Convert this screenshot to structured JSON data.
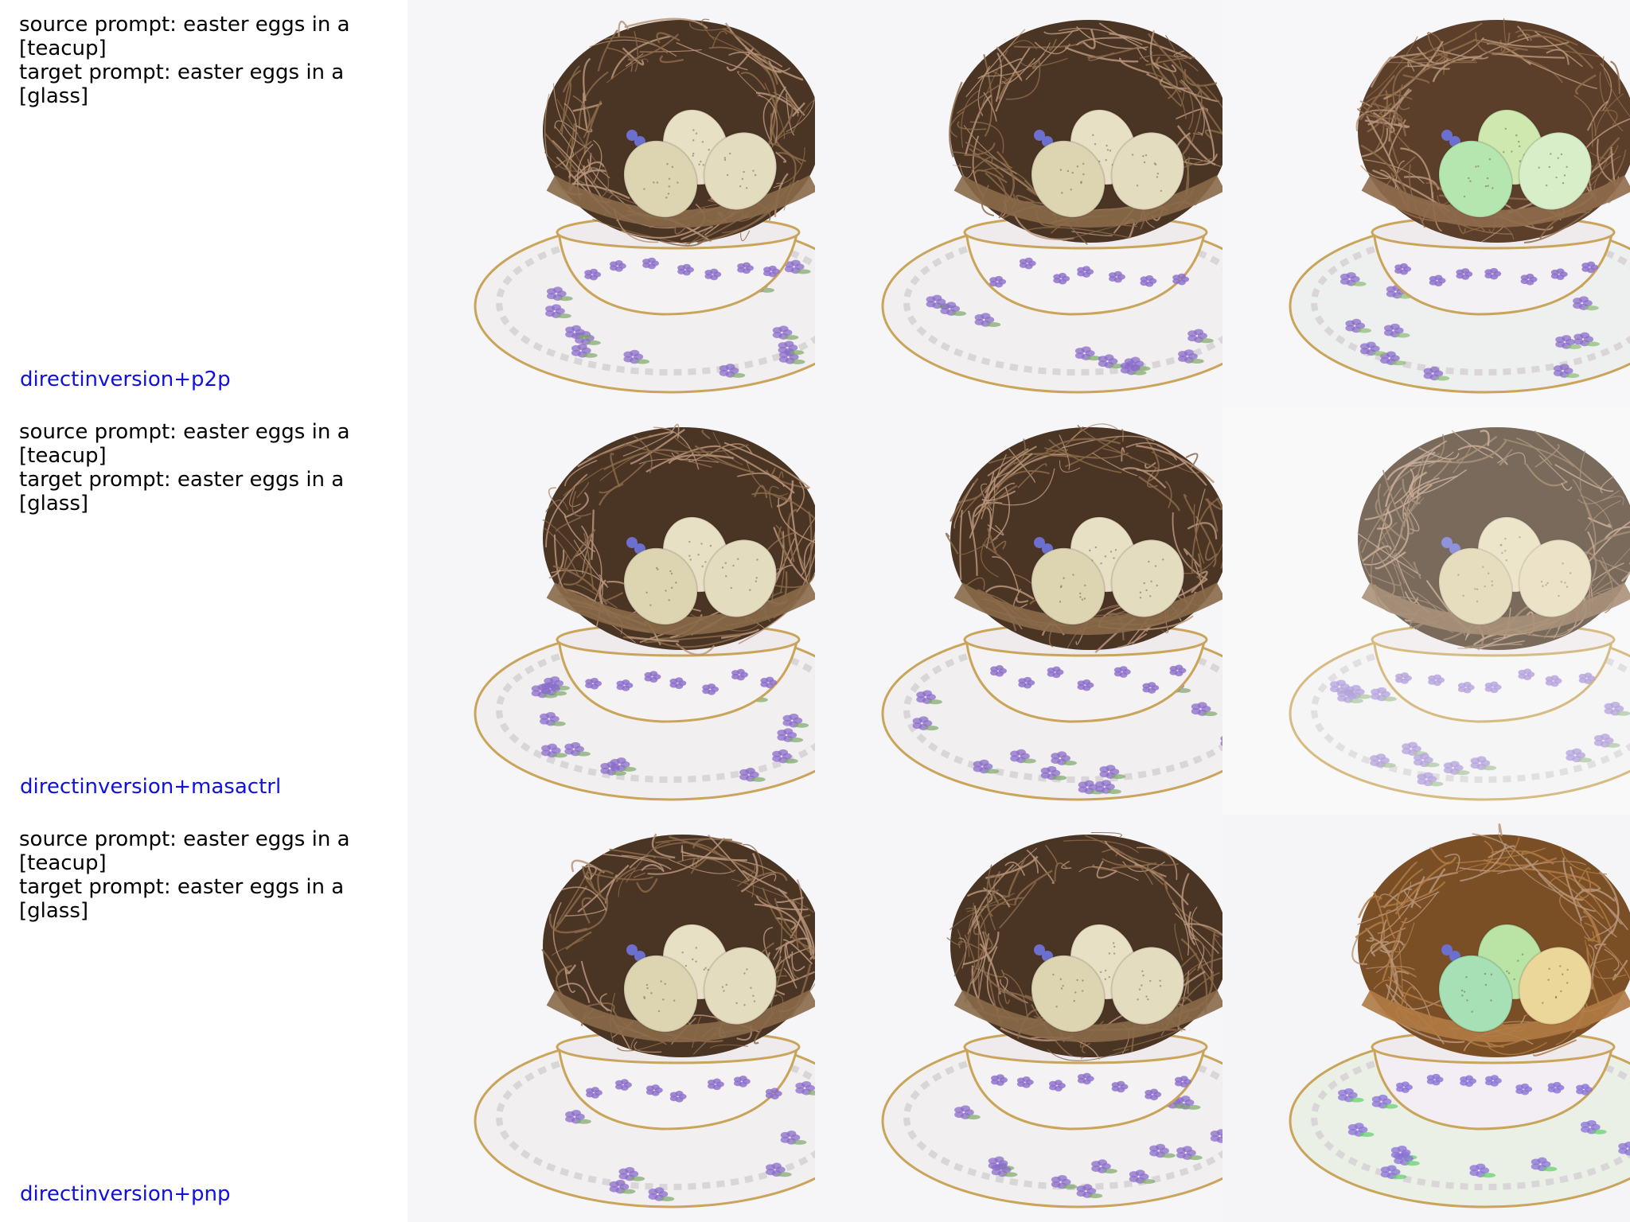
{
  "rows": [
    {
      "source_prompt": "source prompt: easter eggs in a [teacup]",
      "target_prompt": "target prompt: easter eggs in a [glass]",
      "method": "directinversion+p2p",
      "images": [
        "teacup-nest-beige-eggs",
        "teacup-nest-beige-eggs",
        "teacup-nest-green-eggs"
      ]
    },
    {
      "source_prompt": "source prompt: easter eggs in a [teacup]",
      "target_prompt": "target prompt: easter eggs in a [glass]",
      "method": "directinversion+masactrl",
      "images": [
        "teacup-nest-beige-eggs",
        "teacup-nest-beige-eggs",
        "teacup-nest-beige-eggs-faded"
      ]
    },
    {
      "source_prompt": "source prompt: easter eggs in a [teacup]",
      "target_prompt": "target prompt: easter eggs in a [glass]",
      "method": "directinversion+pnp",
      "images": [
        "teacup-nest-beige-eggs",
        "teacup-nest-beige-eggs",
        "glass-nest-pastel-eggs"
      ]
    }
  ],
  "colors": {
    "method_label": "#1010e0",
    "prompt_text": "#000000"
  }
}
